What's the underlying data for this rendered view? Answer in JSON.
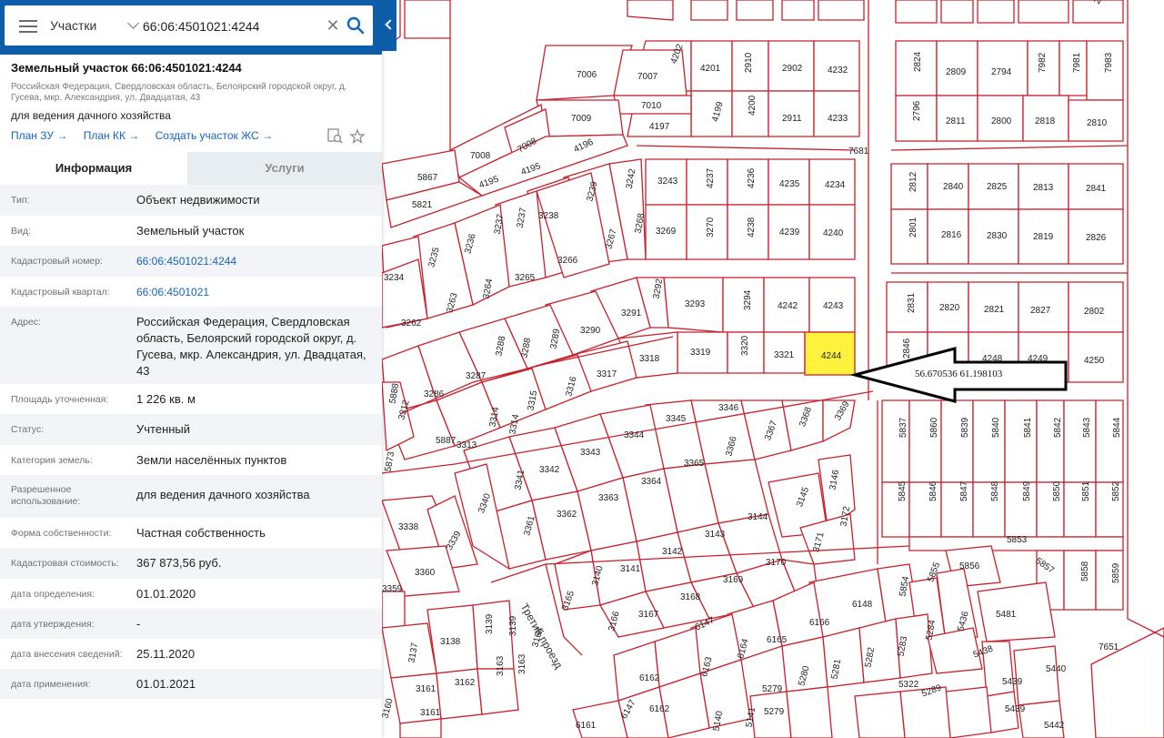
{
  "search": {
    "layer": "Участки",
    "query": "66:06:4501021:4244"
  },
  "object": {
    "title": "Земельный участок 66:06:4501021:4244",
    "address_short": "Российская Федерация, Свердловская область, Белоярский городской округ, д. Гусева, мкр. Александрия, ул. Двадцатая, 43",
    "use": "для ведения дачного хозяйства",
    "links": [
      "План ЗУ →",
      "План КК →",
      "Создать участок ЖС →"
    ]
  },
  "tabs": {
    "info": "Информация",
    "services": "Услуги"
  },
  "properties": [
    {
      "key": "Тип:",
      "value": "Объект недвижимости"
    },
    {
      "key": "Вид:",
      "value": "Земельный участок"
    },
    {
      "key": "Кадастровый номер:",
      "value": "66:06:4501021:4244",
      "link": true
    },
    {
      "key": "Кадастровый квартал:",
      "value": "66:06:4501021",
      "link": true
    },
    {
      "key": "Адрес:",
      "value": "Российская Федерация, Свердловская область, Белоярский городской округ, д. Гусева, мкр. Александрия, ул. Двадцатая, 43"
    },
    {
      "key": "Площадь уточненная:",
      "value": "1 226 кв. м"
    },
    {
      "key": "Статус:",
      "value": "Учтенный"
    },
    {
      "key": "Категория земель:",
      "value": "Земли населённых пунктов"
    },
    {
      "key": "Разрешенное использование:",
      "value": "для ведения дачного хозяйства"
    },
    {
      "key": "Форма собственности:",
      "value": "Частная собственность"
    },
    {
      "key": "Кадастровая стоимость:",
      "value": "367 873,56 руб."
    },
    {
      "key": "дата определения:",
      "value": "01.01.2020"
    },
    {
      "key": "дата утверждения:",
      "value": "-"
    },
    {
      "key": "дата внесения сведений:",
      "value": "25.11.2020"
    },
    {
      "key": "дата применения:",
      "value": "01.01.2021"
    }
  ],
  "map": {
    "selected_parcel": "4244",
    "coordinates_label": "56.670536 61.198103",
    "street_label": "Третий проезд",
    "colors": {
      "parcel_border": "#c8202c",
      "selected_fill": "#fef23c",
      "header": "#0d5da8",
      "link": "#1565c0"
    },
    "parcels": [
      "4202",
      "4201",
      "2910",
      "2902",
      "4232",
      "2824",
      "2809",
      "2794",
      "7982",
      "7981",
      "7983",
      "7006",
      "7007",
      "7010",
      "7009",
      "4197",
      "4199",
      "4200",
      "2911",
      "4233",
      "2796",
      "2811",
      "2800",
      "2818",
      "2810",
      "7008",
      "7008",
      "4196",
      "4195",
      "5867",
      "5821",
      "3243",
      "4237",
      "4236",
      "4235",
      "4234",
      "7681",
      "2812",
      "2840",
      "2825",
      "2813",
      "2841",
      "3242",
      "3239",
      "3238",
      "3237",
      "3236",
      "3235",
      "3234",
      "3269",
      "3270",
      "4238",
      "4239",
      "4240",
      "2801",
      "2816",
      "2830",
      "2819",
      "2826",
      "3268",
      "3267",
      "3266",
      "3265",
      "3264",
      "3263",
      "3262",
      "3292",
      "3293",
      "3294",
      "4242",
      "4243",
      "2831",
      "2820",
      "2821",
      "2827",
      "2802",
      "3291",
      "3290",
      "3289",
      "3288",
      "3288",
      "3287",
      "3286",
      "3319",
      "3320",
      "3321",
      "4244",
      "2846",
      "4248",
      "4249",
      "4250",
      "3318",
      "3317",
      "3316",
      "3315",
      "3314",
      "3314",
      "3313",
      "3312",
      "5888",
      "5887",
      "3346",
      "3345",
      "3344",
      "3343",
      "3342",
      "3341",
      "3340",
      "3367",
      "3366",
      "3365",
      "3364",
      "3363",
      "3362",
      "3361",
      "3368",
      "3369",
      "3146",
      "3145",
      "3144",
      "3143",
      "3142",
      "3141",
      "3140",
      "3172",
      "3171",
      "3170",
      "3169",
      "3168",
      "3167",
      "3166",
      "3165",
      "5837",
      "5860",
      "5839",
      "5840",
      "5841",
      "5842",
      "5843",
      "5844",
      "5845",
      "5846",
      "5847",
      "5848",
      "5849",
      "5850",
      "5851",
      "5852",
      "5853",
      "5856",
      "5857",
      "5858",
      "5859",
      "5855",
      "5854",
      "6148",
      "6147",
      "6166",
      "6165",
      "6164",
      "6163",
      "6162",
      "5481",
      "5436",
      "5284",
      "5283",
      "5282",
      "5281",
      "5280",
      "5279",
      "5438",
      "5439",
      "5440",
      "5289",
      "5322",
      "5288",
      "5441",
      "5442",
      "5141",
      "5140",
      "6161",
      "6147",
      "3138",
      "3139",
      "3137",
      "3136",
      "3164",
      "3163",
      "3162",
      "3161",
      "3160",
      "3338",
      "3339",
      "3360",
      "5873",
      "7651",
      "3359"
    ]
  }
}
